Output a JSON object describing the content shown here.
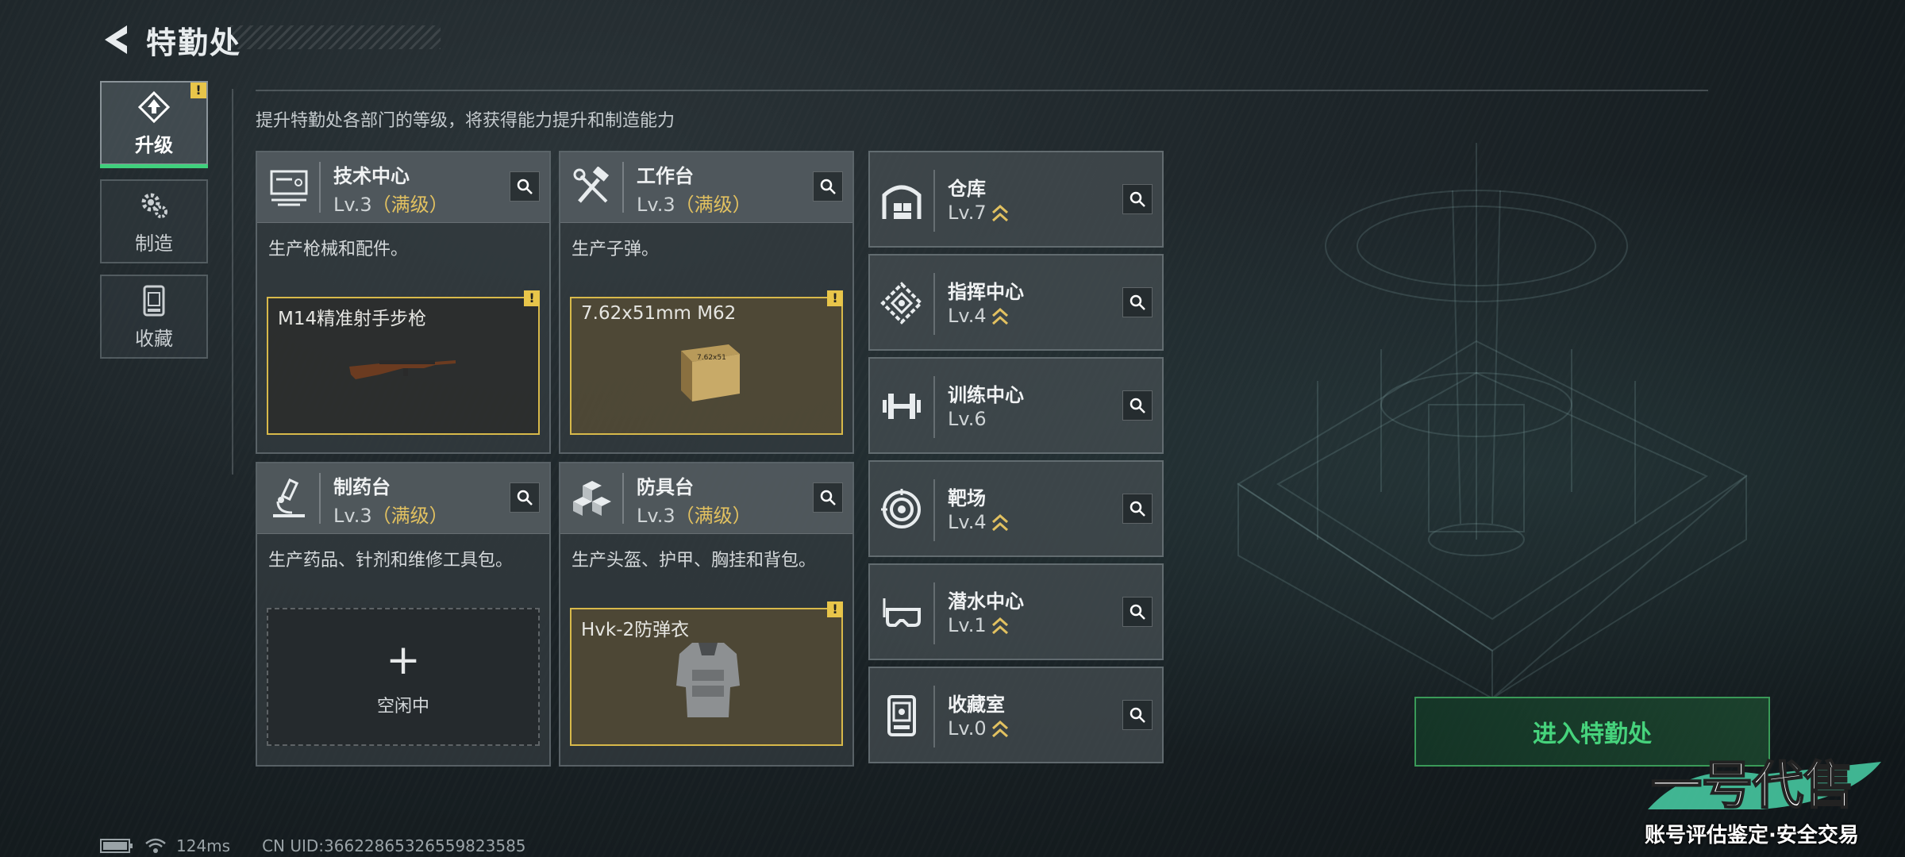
{
  "header": {
    "title": "特勤处"
  },
  "sidebar": [
    {
      "label": "升级",
      "icon": "upgrade-icon",
      "active": true,
      "alert": "!"
    },
    {
      "label": "制造",
      "icon": "gears-icon",
      "active": false
    },
    {
      "label": "收藏",
      "icon": "collection-icon",
      "active": false
    }
  ],
  "subtitle": "提升特勤处各部门的等级，将获得能力提升和制造能力",
  "departments": [
    {
      "name": "技术中心",
      "level": "Lv.3",
      "max": "（满级）",
      "desc": "生产枪械和配件。",
      "slot": {
        "name": "M14精准射手步枪",
        "alert": "!"
      }
    },
    {
      "name": "工作台",
      "level": "Lv.3",
      "max": "（满级）",
      "desc": "生产子弹。",
      "slot": {
        "name": "7.62x51mm M62",
        "alert": "!",
        "box_text": "7.62x51"
      }
    },
    {
      "name": "制药台",
      "level": "Lv.3",
      "max": "（满级）",
      "desc": "生产药品、针剂和维修工具包。",
      "slot": {
        "plus": "+",
        "status": "空闲中"
      }
    },
    {
      "name": "防具台",
      "level": "Lv.3",
      "max": "（满级）",
      "desc": "生产头盔、护甲、胸挂和背包。",
      "slot": {
        "name": "Hvk-2防弹衣",
        "alert": "!"
      }
    }
  ],
  "facilities": [
    {
      "name": "仓库",
      "level": "Lv.7",
      "upgrade": true,
      "icon": "warehouse-icon"
    },
    {
      "name": "指挥中心",
      "level": "Lv.4",
      "upgrade": true,
      "icon": "command-center-icon"
    },
    {
      "name": "训练中心",
      "level": "Lv.6",
      "upgrade": false,
      "icon": "dumbbell-icon"
    },
    {
      "name": "靶场",
      "level": "Lv.4",
      "upgrade": true,
      "icon": "target-icon"
    },
    {
      "name": "潜水中心",
      "level": "Lv.1",
      "upgrade": true,
      "icon": "goggles-icon"
    },
    {
      "name": "收藏室",
      "level": "Lv.0",
      "upgrade": true,
      "icon": "collection-room-icon"
    }
  ],
  "enter_button": "进入特勤处",
  "status": {
    "ping": "124ms",
    "uid": "CN UID:36622865326559823585"
  },
  "watermark": {
    "logo": "一号代售",
    "tagline": "账号评估鉴定·安全交易"
  },
  "colors": {
    "accent": "#3fd07c",
    "gold": "#e2c160",
    "alert": "#e8c54a"
  }
}
